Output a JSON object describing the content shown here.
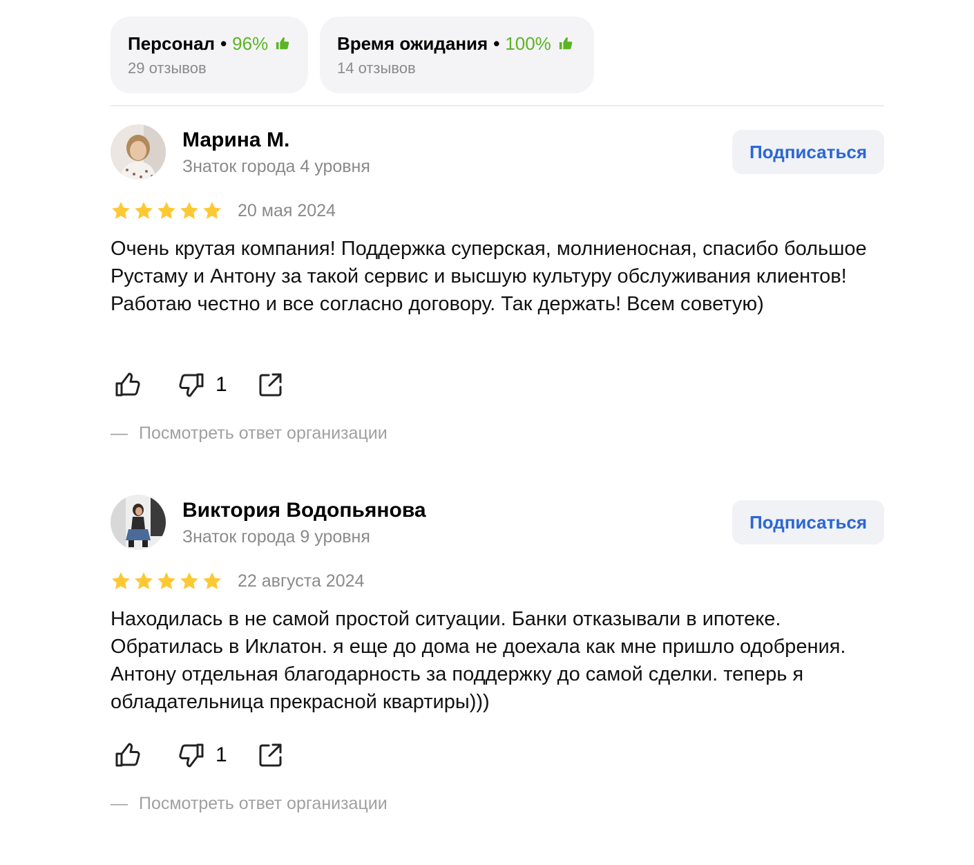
{
  "aspects": [
    {
      "label": "Персонал",
      "percent": "96%",
      "reviews": "29 отзывов",
      "icon": "thumb-up-icon"
    },
    {
      "label": "Время ожидания",
      "percent": "100%",
      "reviews": "14 отзывов",
      "icon": "thumb-up-icon"
    }
  ],
  "colors": {
    "positive": "#5bb424",
    "link": "#2b66d7",
    "star": "#fcc934",
    "muted": "#8a8a8a",
    "chip_bg": "#f4f4f6"
  },
  "reviews": [
    {
      "author": "Марина М.",
      "level": "Знаток города 4 уровня",
      "subscribe_label": "Подписаться",
      "rating": 5,
      "date": "20 мая 2024",
      "text": "Очень крутая компания! Поддержка суперская, молниеносная, спасибо большое Рустаму и Антону за такой сервис и высшую культуру обслуживания клиентов! Работаю честно и все согласно договору. Так держать! Всем советую)",
      "dislikes": "1",
      "org_answer_dash": "—",
      "org_answer_label": "Посмотреть ответ организации"
    },
    {
      "author": "Виктория Водопьянова",
      "level": "Знаток города 9 уровня",
      "subscribe_label": "Подписаться",
      "rating": 5,
      "date": "22 августа 2024",
      "text": "Находилась в не самой простой ситуации. Банки отказывали в ипотеке. Обратилась в Иклатон. я еще до дома не доехала как мне пришло одобрения. Антону отдельная благодарность за поддержку до самой сделки. теперь я обладательница прекрасной квартиры)))",
      "dislikes": "1",
      "org_answer_dash": "—",
      "org_answer_label": "Посмотреть ответ организации"
    }
  ]
}
